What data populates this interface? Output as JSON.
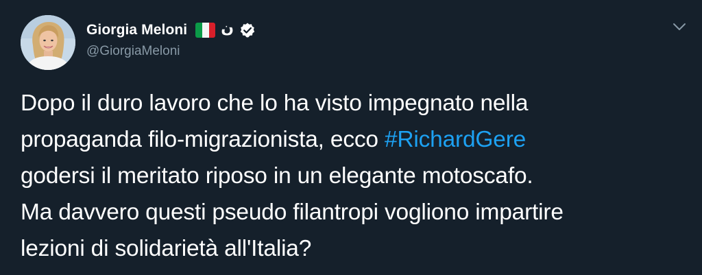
{
  "author": {
    "display_name": "Giorgia Meloni",
    "handle": "@GiorgiaMeloni",
    "name_suffix": "ن",
    "verified": true
  },
  "icons": {
    "flag": "italy-flag-icon",
    "verified": "verified-badge-icon",
    "menu": "chevron-down-icon"
  },
  "colors": {
    "background": "#15202b",
    "text": "#ffffff",
    "muted": "#8899a6",
    "link": "#1da1f2",
    "verified_badge": "#ffffff"
  },
  "tweet": {
    "lines": [
      {
        "text": "Dopo il duro lavoro che lo ha visto impegnato nella"
      },
      {
        "before": "propaganda filo-migrazionista, ecco ",
        "hashtag": "#RichardGere"
      },
      {
        "text": "godersi il meritato riposo in un elegante motoscafo."
      },
      {
        "text": "Ma davvero questi pseudo filantropi vogliono impartire"
      },
      {
        "text": "lezioni di solidarietà all'Italia?"
      }
    ]
  }
}
